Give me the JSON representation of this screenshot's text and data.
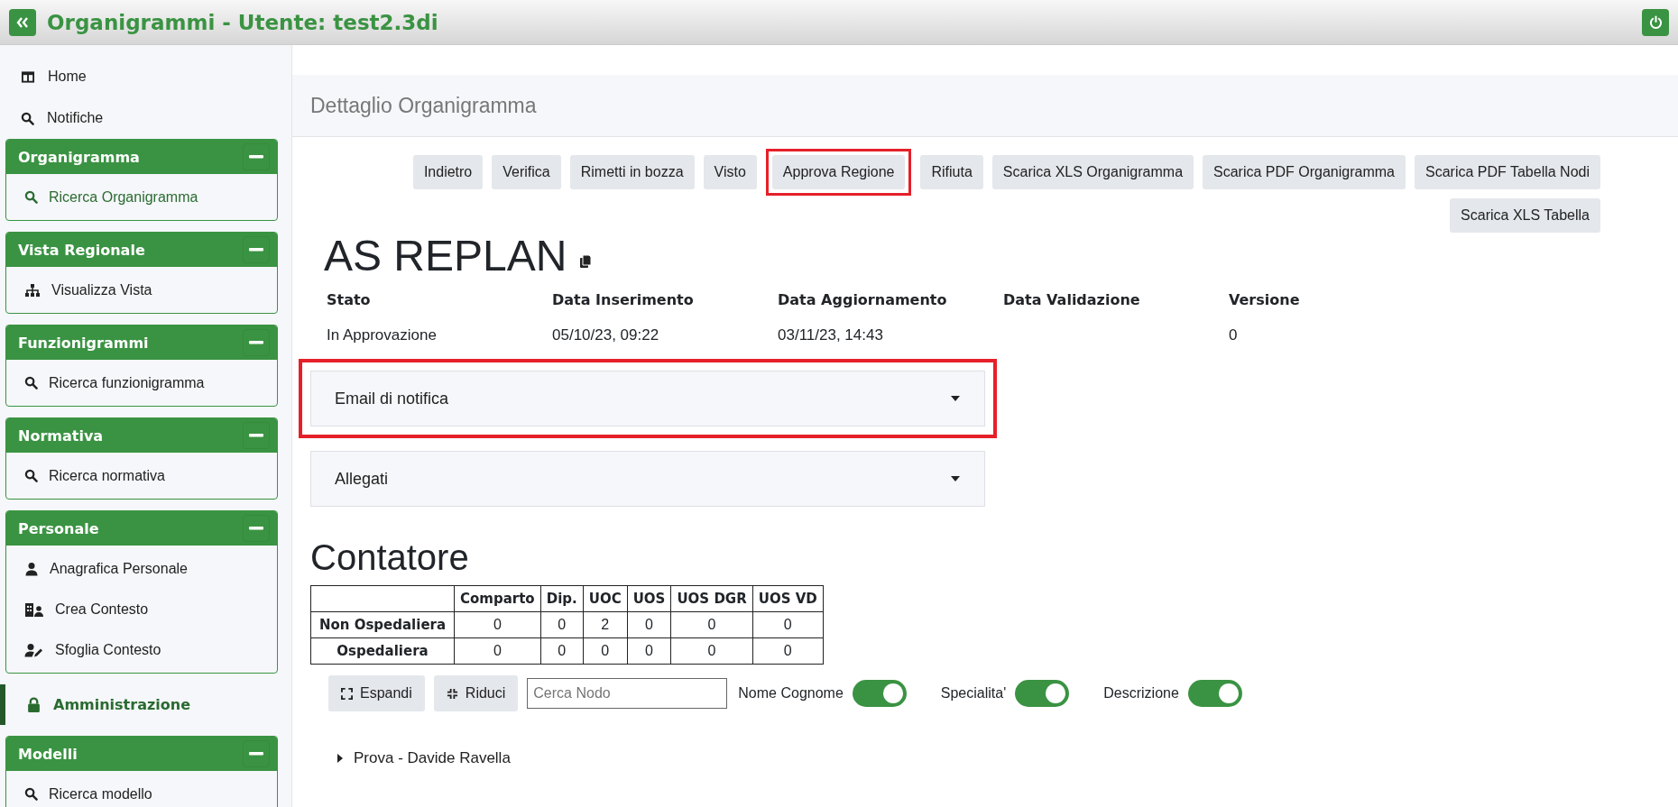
{
  "header": {
    "title": "Organigrammi - Utente: test2.3di"
  },
  "sidebar": {
    "links": [
      {
        "label": "Home"
      },
      {
        "label": "Notifiche"
      }
    ],
    "sections": [
      {
        "kind": "group",
        "title": "Organigramma",
        "expanded": true,
        "items": [
          {
            "label": "Ricerca Organigramma",
            "selected": true
          }
        ]
      },
      {
        "kind": "group",
        "title": "Vista Regionale",
        "expanded": true,
        "items": [
          {
            "label": "Visualizza Vista",
            "selected": false
          }
        ]
      },
      {
        "kind": "group",
        "title": "Funzionigrammi",
        "expanded": true,
        "items": [
          {
            "label": "Ricerca funzionigramma",
            "selected": false
          }
        ]
      },
      {
        "kind": "group",
        "title": "Normativa",
        "expanded": true,
        "items": [
          {
            "label": "Ricerca normativa",
            "selected": false
          }
        ]
      },
      {
        "kind": "group",
        "title": "Personale",
        "expanded": true,
        "items": [
          {
            "label": "Anagrafica Personale",
            "selected": false
          },
          {
            "label": "Crea Contesto",
            "selected": false
          },
          {
            "label": "Sfoglia Contesto",
            "selected": false
          }
        ]
      },
      {
        "kind": "link",
        "title": "Amministrazione",
        "selected": true
      },
      {
        "kind": "group",
        "title": "Modelli",
        "expanded": true,
        "items": [
          {
            "label": "Ricerca modello",
            "selected": false
          }
        ]
      }
    ]
  },
  "page": {
    "title": "Dettaglio Organigramma",
    "actions": [
      {
        "label": "Indietro",
        "highlighted": false
      },
      {
        "label": "Verifica",
        "highlighted": false
      },
      {
        "label": "Rimetti in bozza",
        "highlighted": false
      },
      {
        "label": "Visto",
        "highlighted": false
      },
      {
        "label": "Approva Regione",
        "highlighted": true
      },
      {
        "label": "Rifiuta",
        "highlighted": false
      },
      {
        "label": "Scarica XLS Organigramma",
        "highlighted": false
      },
      {
        "label": "Scarica PDF Organigramma",
        "highlighted": false
      },
      {
        "label": "Scarica PDF Tabella Nodi",
        "highlighted": false
      },
      {
        "label": "Scarica XLS Tabella",
        "highlighted": false
      }
    ],
    "name": "AS REPLAN",
    "details": [
      {
        "label": "Stato",
        "value": "In Approvazione"
      },
      {
        "label": "Data Inserimento",
        "value": "05/10/23, 09:22"
      },
      {
        "label": "Data Aggiornamento",
        "value": "03/11/23, 14:43"
      },
      {
        "label": "Data Validazione"
      },
      {
        "label": "Versione",
        "value": "0"
      }
    ],
    "accordions": [
      {
        "title": "Email di notifica",
        "expanded": false,
        "highlighted": true
      },
      {
        "title": "Allegati",
        "expanded": false,
        "highlighted": false
      }
    ],
    "counter": {
      "title": "Contatore",
      "columns": [
        "Comparto",
        "Dip.",
        "UOC",
        "UOS",
        "UOS DGR",
        "UOS VD"
      ],
      "rows": [
        {
          "label": "Non Ospedaliera",
          "values": [
            "0",
            "0",
            "2",
            "0",
            "0",
            "0"
          ]
        },
        {
          "label": "Ospedaliera",
          "values": [
            "0",
            "0",
            "0",
            "0",
            "0",
            "0"
          ]
        }
      ]
    },
    "tree_controls": {
      "expand": "Espandi",
      "collapse": "Riduci",
      "search": {
        "placeholder": "Cerca Nodo"
      },
      "toggles": [
        {
          "label": "Nome Cognome",
          "on": true
        },
        {
          "label": "Specialita'",
          "on": true
        },
        {
          "label": "Descrizione",
          "on": true
        }
      ]
    },
    "tree": [
      {
        "label": "Prova - Davide Ravella",
        "expanded": false
      }
    ]
  }
}
